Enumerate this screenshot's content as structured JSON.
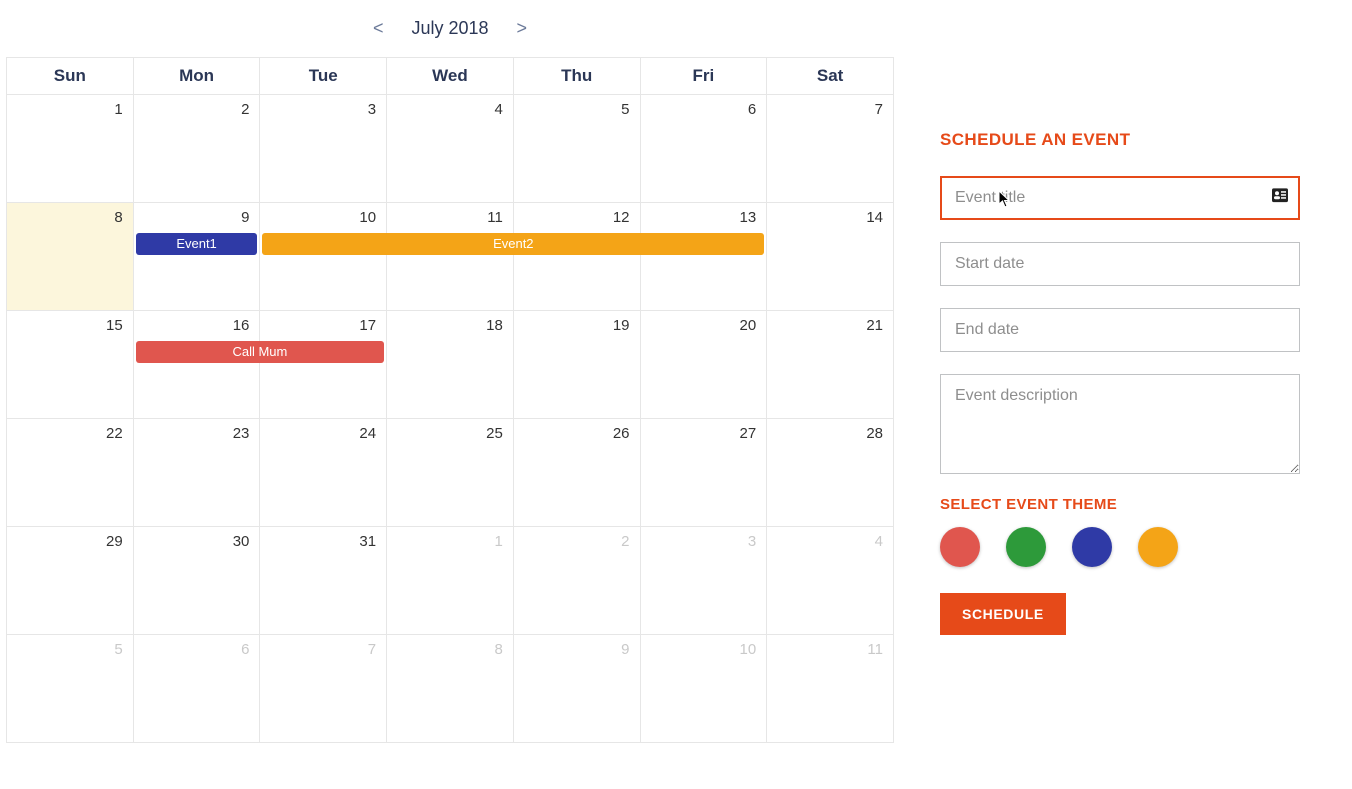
{
  "header": {
    "prev": "<",
    "title": "July 2018",
    "next": ">"
  },
  "weekdays": [
    "Sun",
    "Mon",
    "Tue",
    "Wed",
    "Thu",
    "Fri",
    "Sat"
  ],
  "weeks": [
    [
      {
        "n": "1",
        "other": false
      },
      {
        "n": "2",
        "other": false
      },
      {
        "n": "3",
        "other": false
      },
      {
        "n": "4",
        "other": false
      },
      {
        "n": "5",
        "other": false
      },
      {
        "n": "6",
        "other": false
      },
      {
        "n": "7",
        "other": false
      }
    ],
    [
      {
        "n": "8",
        "other": false,
        "today": true
      },
      {
        "n": "9",
        "other": false
      },
      {
        "n": "10",
        "other": false
      },
      {
        "n": "11",
        "other": false
      },
      {
        "n": "12",
        "other": false
      },
      {
        "n": "13",
        "other": false
      },
      {
        "n": "14",
        "other": false
      }
    ],
    [
      {
        "n": "15",
        "other": false
      },
      {
        "n": "16",
        "other": false
      },
      {
        "n": "17",
        "other": false
      },
      {
        "n": "18",
        "other": false
      },
      {
        "n": "19",
        "other": false
      },
      {
        "n": "20",
        "other": false
      },
      {
        "n": "21",
        "other": false
      }
    ],
    [
      {
        "n": "22",
        "other": false
      },
      {
        "n": "23",
        "other": false
      },
      {
        "n": "24",
        "other": false
      },
      {
        "n": "25",
        "other": false
      },
      {
        "n": "26",
        "other": false
      },
      {
        "n": "27",
        "other": false
      },
      {
        "n": "28",
        "other": false
      }
    ],
    [
      {
        "n": "29",
        "other": false
      },
      {
        "n": "30",
        "other": false
      },
      {
        "n": "31",
        "other": false
      },
      {
        "n": "1",
        "other": true
      },
      {
        "n": "2",
        "other": true
      },
      {
        "n": "3",
        "other": true
      },
      {
        "n": "4",
        "other": true
      }
    ],
    [
      {
        "n": "5",
        "other": true
      },
      {
        "n": "6",
        "other": true
      },
      {
        "n": "7",
        "other": true
      },
      {
        "n": "8",
        "other": true
      },
      {
        "n": "9",
        "other": true
      },
      {
        "n": "10",
        "other": true
      },
      {
        "n": "11",
        "other": true
      }
    ]
  ],
  "events": [
    {
      "row": 1,
      "startCol": 1,
      "span": 1,
      "label": "Event1",
      "color": "#2f3aa6"
    },
    {
      "row": 1,
      "startCol": 2,
      "span": 4,
      "label": "Event2",
      "color": "#f4a417"
    },
    {
      "row": 2,
      "startCol": 1,
      "span": 2,
      "label": "Call Mum",
      "color": "#e0564e"
    }
  ],
  "side": {
    "title": "SCHEDULE AN EVENT",
    "event_title_placeholder": "Event title",
    "start_placeholder": "Start date",
    "end_placeholder": "End date",
    "desc_placeholder": "Event description",
    "theme_label": "SELECT EVENT THEME",
    "button": "SCHEDULE"
  },
  "themes": [
    {
      "color": "#e0564e"
    },
    {
      "color": "#2d9a3a"
    },
    {
      "color": "#2f3aa6"
    },
    {
      "color": "#f4a417"
    }
  ]
}
